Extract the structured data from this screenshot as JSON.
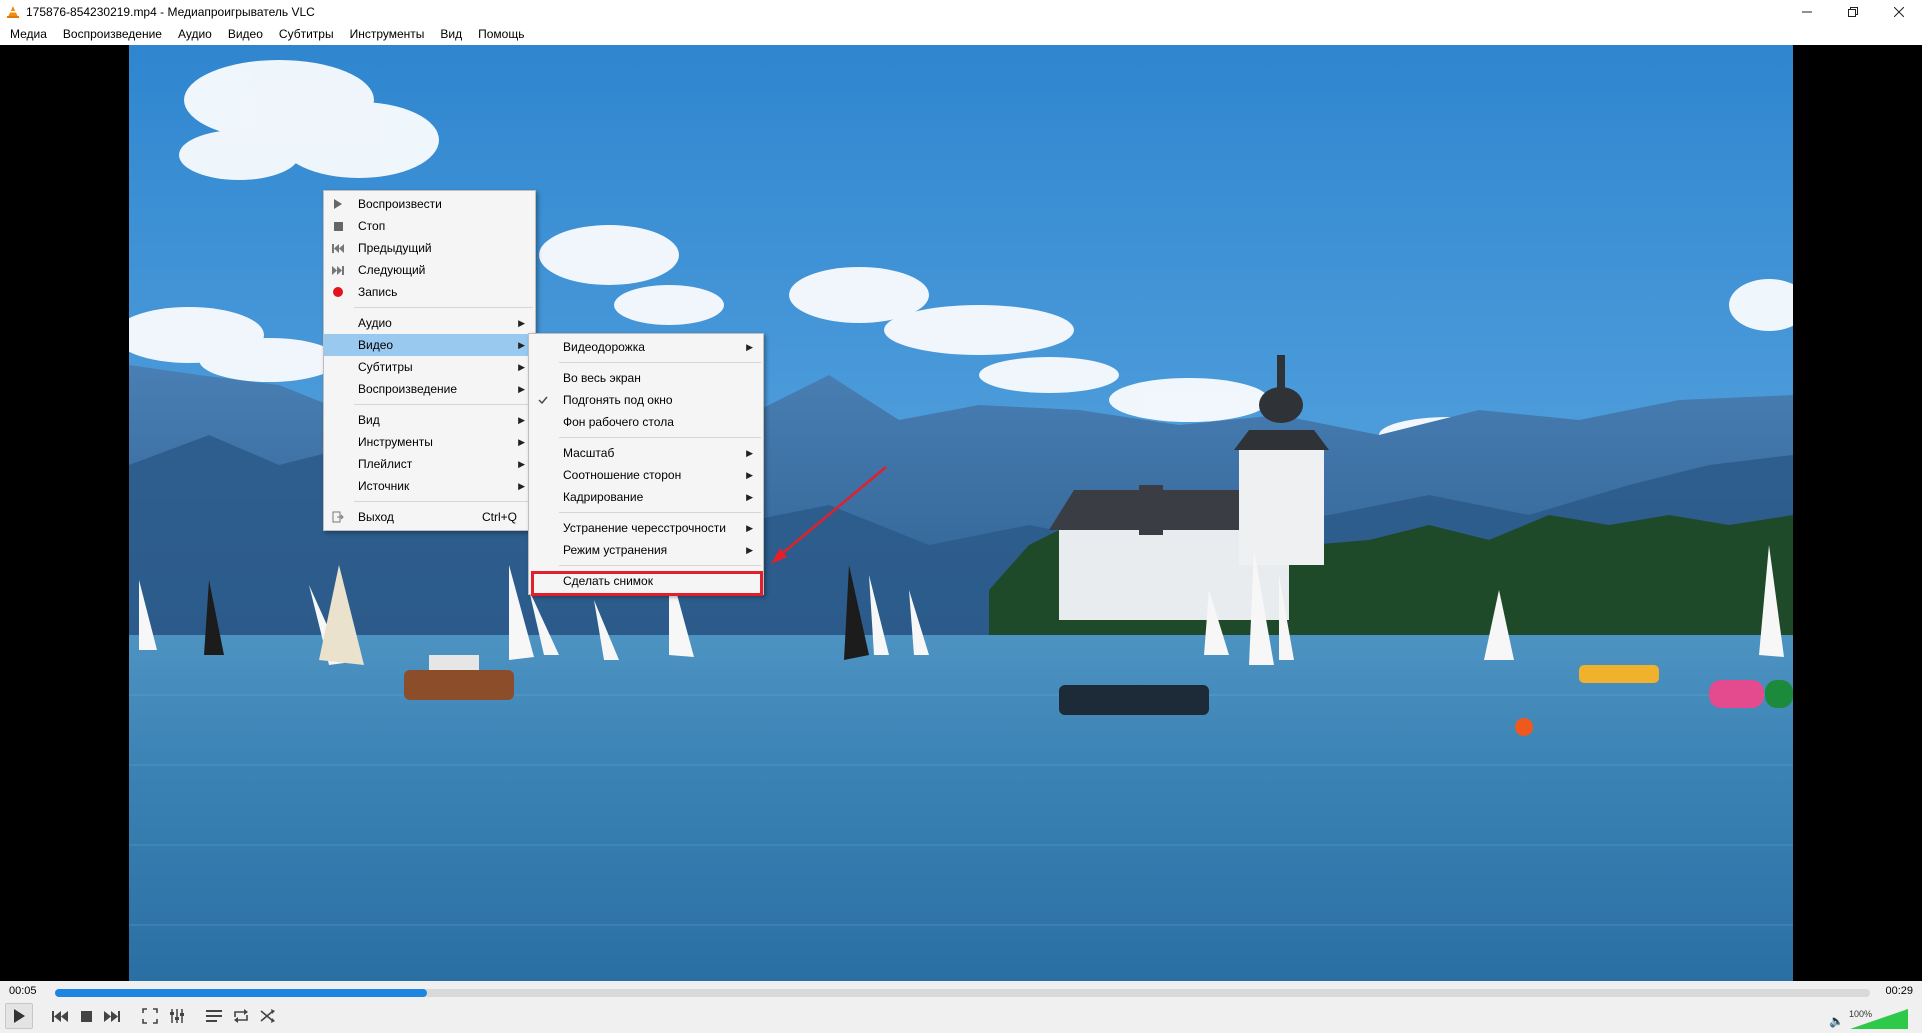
{
  "window": {
    "title": "175876-854230219.mp4 - Медиапроигрыватель VLC"
  },
  "menubar": [
    "Медиа",
    "Воспроизведение",
    "Аудио",
    "Видео",
    "Субтитры",
    "Инструменты",
    "Вид",
    "Помощь"
  ],
  "context_menu": {
    "items": [
      {
        "label": "Воспроизвести",
        "icon": "play-icon"
      },
      {
        "label": "Стоп",
        "icon": "stop-icon"
      },
      {
        "label": "Предыдущий",
        "icon": "previous-icon"
      },
      {
        "label": "Следующий",
        "icon": "next-icon"
      },
      {
        "label": "Запись",
        "icon": "record-icon"
      },
      {
        "label": "Аудио",
        "submenu": true
      },
      {
        "label": "Видео",
        "submenu": true
      },
      {
        "label": "Субтитры",
        "submenu": true
      },
      {
        "label": "Воспроизведение",
        "submenu": true
      },
      {
        "label": "Вид",
        "submenu": true
      },
      {
        "label": "Инструменты",
        "submenu": true
      },
      {
        "label": "Плейлист",
        "submenu": true
      },
      {
        "label": "Источник",
        "submenu": true
      },
      {
        "label": "Выход",
        "shortcut": "Ctrl+Q",
        "icon": "exit-icon"
      }
    ]
  },
  "video_submenu": {
    "items": [
      {
        "label": "Видеодорожка",
        "submenu": true
      },
      {
        "label": "Во весь экран"
      },
      {
        "label": "Подгонять под окно",
        "checked": true
      },
      {
        "label": "Фон рабочего стола"
      },
      {
        "label": "Масштаб",
        "submenu": true
      },
      {
        "label": "Соотношение сторон",
        "submenu": true
      },
      {
        "label": "Кадрирование",
        "submenu": true
      },
      {
        "label": "Устранение чересстрочности",
        "submenu": true
      },
      {
        "label": "Режим устранения",
        "submenu": true
      },
      {
        "label": "Сделать снимок",
        "highlighted_annotation": true
      }
    ]
  },
  "playback": {
    "elapsed": "00:05",
    "total": "00:29",
    "progress_fraction": 0.205,
    "volume": "100%"
  },
  "colors": {
    "accent": "#1e86e0",
    "menu_highlight": "#99c9ef",
    "annotation_red": "#e2202c"
  }
}
